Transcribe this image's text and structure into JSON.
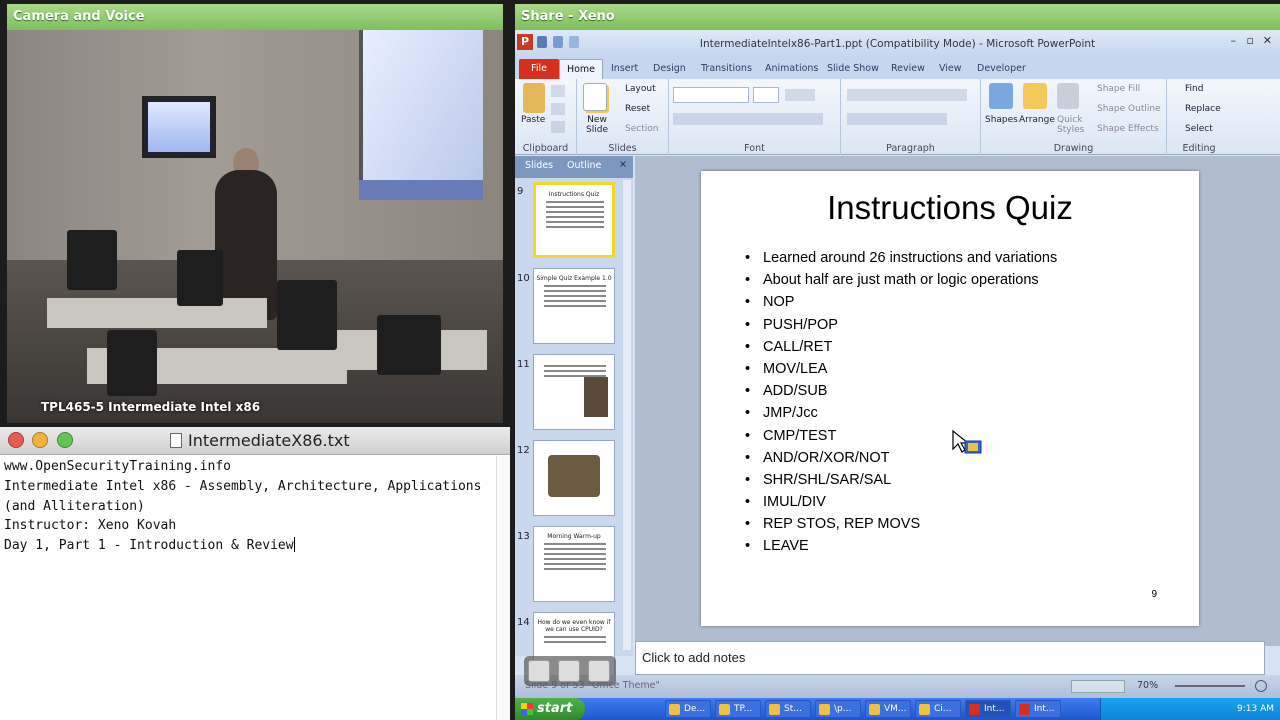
{
  "camera_panel": {
    "title": "Camera and Voice",
    "caption": "TPL465-5 Intermediate Intel x86"
  },
  "share_panel": {
    "title": "Share - Xeno"
  },
  "notepad": {
    "filename": "IntermediateX86.txt",
    "lines": [
      "www.OpenSecurityTraining.info",
      "Intermediate Intel x86 - Assembly, Architecture, Applications",
      "(and Alliteration)",
      "Instructor: Xeno Kovah",
      "Day 1, Part 1 - Introduction & Review"
    ]
  },
  "ppt": {
    "window_title": "IntermediateIntelx86-Part1.ppt (Compatibility Mode) - Microsoft PowerPoint",
    "logo_letter": "P",
    "tabs": [
      "File",
      "Home",
      "Insert",
      "Design",
      "Transitions",
      "Animations",
      "Slide Show",
      "Review",
      "View",
      "Developer"
    ],
    "ribbon": {
      "clipboard": {
        "label": "Clipboard",
        "paste": "Paste"
      },
      "slides": {
        "label": "Slides",
        "new_slide": "New Slide",
        "layout": "Layout",
        "reset": "Reset",
        "section": "Section"
      },
      "font": {
        "label": "Font"
      },
      "paragraph": {
        "label": "Paragraph"
      },
      "drawing": {
        "label": "Drawing",
        "shapes": "Shapes",
        "arrange": "Arrange",
        "quick_styles": "Quick Styles",
        "shape_fill": "Shape Fill",
        "shape_outline": "Shape Outline",
        "shape_effects": "Shape Effects"
      },
      "editing": {
        "label": "Editing",
        "find": "Find",
        "replace": "Replace",
        "select": "Select"
      }
    },
    "pane_tabs": {
      "slides": "Slides",
      "outline": "Outline",
      "close": "×"
    },
    "thumbnails": [
      {
        "num": "9",
        "title": "Instructions Quiz"
      },
      {
        "num": "10",
        "title": "Simple Quiz Example 1.0"
      },
      {
        "num": "11",
        "title": ""
      },
      {
        "num": "12",
        "title": ""
      },
      {
        "num": "13",
        "title": "Morning Warm-up"
      },
      {
        "num": "14",
        "title": "How do we even know if we can use CPUID?"
      }
    ],
    "slide": {
      "title": "Instructions Quiz",
      "bullets": [
        "Learned around 26 instructions and variations",
        "About half are just math or logic operations",
        "NOP",
        "PUSH/POP",
        "CALL/RET",
        "MOV/LEA",
        "ADD/SUB",
        "JMP/Jcc",
        "CMP/TEST",
        "AND/OR/XOR/NOT",
        "SHR/SHL/SAR/SAL",
        "IMUL/DIV",
        "REP STOS, REP MOVS",
        "LEAVE"
      ],
      "number": "9"
    },
    "notes_placeholder": "Click to add notes",
    "status": {
      "left": "Slide 9 of 53   \"Office Theme\"",
      "zoom": "70%"
    }
  },
  "taskbar": {
    "start": "start",
    "items": [
      "De...",
      "TP...",
      "St...",
      "\\p...",
      "VM...",
      "Ci...",
      "Int...",
      "Int..."
    ],
    "clock": "9:13 AM"
  }
}
